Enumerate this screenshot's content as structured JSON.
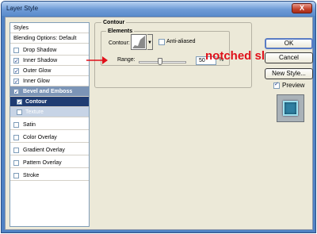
{
  "window": {
    "title": "Layer Style",
    "close_label": "X"
  },
  "styles_panel": {
    "items": [
      {
        "label": "Styles",
        "checked": null
      },
      {
        "label": "Blending Options: Default",
        "checked": null
      },
      {
        "label": "Drop Shadow",
        "checked": false
      },
      {
        "label": "Inner Shadow",
        "checked": true
      },
      {
        "label": "Outer Glow",
        "checked": true
      },
      {
        "label": "Inner Glow",
        "checked": true
      },
      {
        "label": "Bevel and Emboss",
        "checked": true
      },
      {
        "label": "Contour",
        "checked": true
      },
      {
        "label": "Texture",
        "checked": false
      },
      {
        "label": "Satin",
        "checked": false
      },
      {
        "label": "Color Overlay",
        "checked": false
      },
      {
        "label": "Gradient Overlay",
        "checked": false
      },
      {
        "label": "Pattern Overlay",
        "checked": false
      },
      {
        "label": "Stroke",
        "checked": false
      }
    ]
  },
  "contour": {
    "group_title": "Contour",
    "subgroup_title": "Elements",
    "contour_label": "Contour:",
    "anti_aliased_label": "Anti-aliased",
    "anti_aliased_checked": false,
    "range_label": "Range:",
    "range_value": "50",
    "range_unit": "%",
    "range_fraction": 0.5
  },
  "annotation": {
    "text": "notched slop",
    "color": "#e0101a"
  },
  "buttons": {
    "ok": "OK",
    "cancel": "Cancel",
    "new_style": "New Style..."
  },
  "preview": {
    "label": "Preview",
    "checked": true
  },
  "colors": {
    "selected_row": "#1f3c72",
    "bevel_row": "#7b94b6",
    "window_frame": "#4f82c4"
  }
}
